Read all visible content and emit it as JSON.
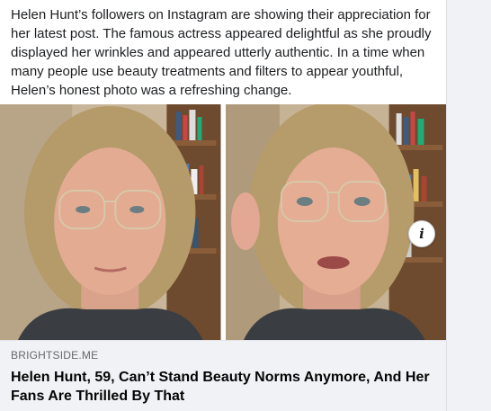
{
  "post": {
    "text": "Helen Hunt’s followers on Instagram are showing their appreciation for her latest post. The famous actress appeared delightful as she proudly displayed her wrinkles and appeared utterly authentic. In a time when many people use beauty treatments and filters to appear youthful, Helen’s honest photo was a refreshing change."
  },
  "link_preview": {
    "domain": "BRIGHTSIDE.ME",
    "title": "Helen Hunt, 59, Can’t Stand Beauty Norms Anymore, And Her Fans Are Thrilled By That",
    "info_icon_glyph": "i"
  },
  "colors": {
    "page_bg": "#f0f2f5",
    "text": "#1c1e21",
    "muted": "#65676b"
  }
}
